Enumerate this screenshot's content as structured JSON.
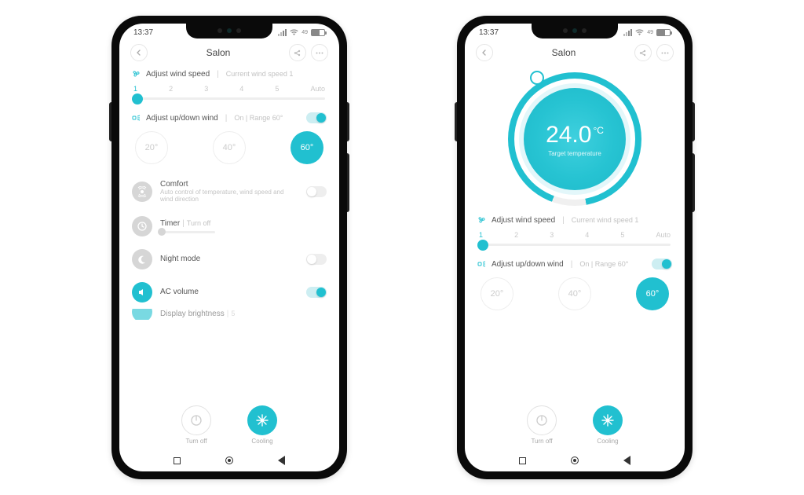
{
  "status": {
    "time": "13:37",
    "battery": "49"
  },
  "header": {
    "title": "Salon"
  },
  "wind": {
    "icon": "fan-icon",
    "title": "Adjust wind speed",
    "subtitle": "Current wind speed 1",
    "labels": [
      "1",
      "2",
      "3",
      "4",
      "5",
      "Auto"
    ],
    "active_index": 0
  },
  "updown": {
    "icon": "swing-icon",
    "title": "Adjust up/down wind",
    "subtitle": "On | Range 60°",
    "enabled": true,
    "options": [
      "20°",
      "40°",
      "60°"
    ],
    "selected": "60°"
  },
  "features": {
    "comfort": {
      "title": "Comfort",
      "desc": "Auto control of temperature, wind speed and wind direction",
      "on": false
    },
    "timer": {
      "title": "Timer",
      "sub": "Turn off",
      "on": false
    },
    "night": {
      "title": "Night mode",
      "on": false
    },
    "volume": {
      "title": "AC volume",
      "on": true
    },
    "brightness": {
      "title": "Display brightness",
      "sub": "5"
    }
  },
  "modes": {
    "turnoff": "Turn off",
    "cooling": "Cooling"
  },
  "dial": {
    "temp": "24.0",
    "unit": "°C",
    "label": "Target temperature"
  }
}
